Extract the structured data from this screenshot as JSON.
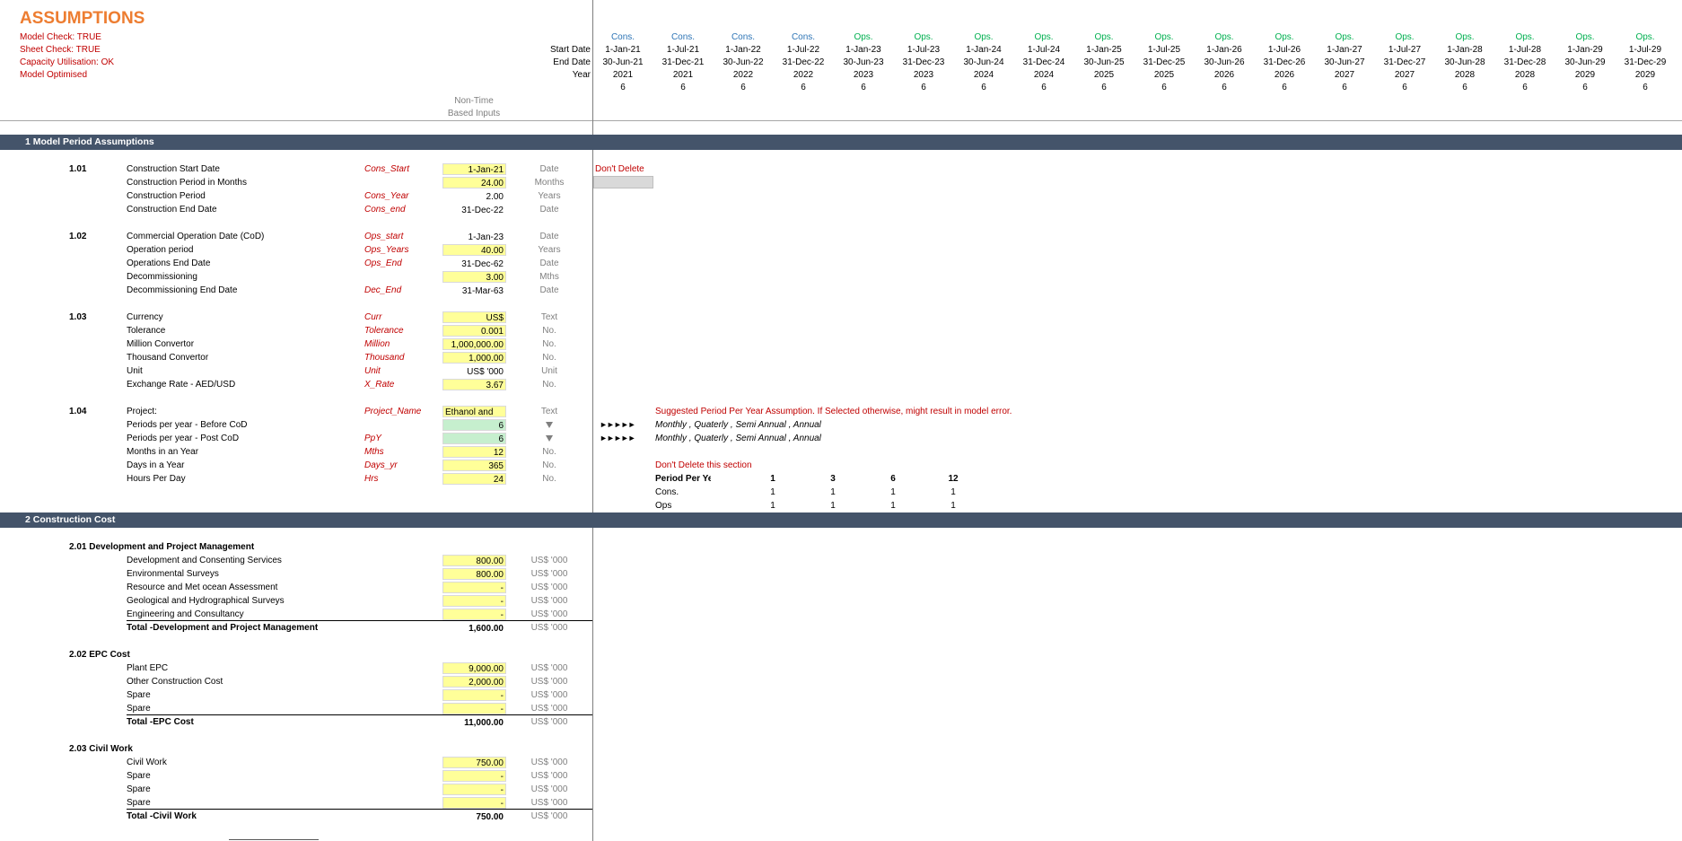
{
  "header": {
    "title": "ASSUMPTIONS",
    "checks": [
      "Model Check: TRUE",
      "Sheet Check: TRUE",
      "Capacity Utilisation: OK",
      "Model Optimised"
    ],
    "non_time_label_1": "Non-Time",
    "non_time_label_2": "Based Inputs"
  },
  "timeline": {
    "row_labels": [
      "Start Date",
      "End Date",
      "Year"
    ],
    "columns": [
      {
        "phase": "Cons.",
        "start": "1-Jan-21",
        "end": "30-Jun-21",
        "year": "2021",
        "periods": "6"
      },
      {
        "phase": "Cons.",
        "start": "1-Jul-21",
        "end": "31-Dec-21",
        "year": "2021",
        "periods": "6"
      },
      {
        "phase": "Cons.",
        "start": "1-Jan-22",
        "end": "30-Jun-22",
        "year": "2022",
        "periods": "6"
      },
      {
        "phase": "Cons.",
        "start": "1-Jul-22",
        "end": "31-Dec-22",
        "year": "2022",
        "periods": "6"
      },
      {
        "phase": "Ops.",
        "start": "1-Jan-23",
        "end": "30-Jun-23",
        "year": "2023",
        "periods": "6"
      },
      {
        "phase": "Ops.",
        "start": "1-Jul-23",
        "end": "31-Dec-23",
        "year": "2023",
        "periods": "6"
      },
      {
        "phase": "Ops.",
        "start": "1-Jan-24",
        "end": "30-Jun-24",
        "year": "2024",
        "periods": "6"
      },
      {
        "phase": "Ops.",
        "start": "1-Jul-24",
        "end": "31-Dec-24",
        "year": "2024",
        "periods": "6"
      },
      {
        "phase": "Ops.",
        "start": "1-Jan-25",
        "end": "30-Jun-25",
        "year": "2025",
        "periods": "6"
      },
      {
        "phase": "Ops.",
        "start": "1-Jul-25",
        "end": "31-Dec-25",
        "year": "2025",
        "periods": "6"
      },
      {
        "phase": "Ops.",
        "start": "1-Jan-26",
        "end": "30-Jun-26",
        "year": "2026",
        "periods": "6"
      },
      {
        "phase": "Ops.",
        "start": "1-Jul-26",
        "end": "31-Dec-26",
        "year": "2026",
        "periods": "6"
      },
      {
        "phase": "Ops.",
        "start": "1-Jan-27",
        "end": "30-Jun-27",
        "year": "2027",
        "periods": "6"
      },
      {
        "phase": "Ops.",
        "start": "1-Jul-27",
        "end": "31-Dec-27",
        "year": "2027",
        "periods": "6"
      },
      {
        "phase": "Ops.",
        "start": "1-Jan-28",
        "end": "30-Jun-28",
        "year": "2028",
        "periods": "6"
      },
      {
        "phase": "Ops.",
        "start": "1-Jul-28",
        "end": "31-Dec-28",
        "year": "2028",
        "periods": "6"
      },
      {
        "phase": "Ops.",
        "start": "1-Jan-29",
        "end": "30-Jun-29",
        "year": "2029",
        "periods": "6"
      },
      {
        "phase": "Ops.",
        "start": "1-Jul-29",
        "end": "31-Dec-29",
        "year": "2029",
        "periods": "6"
      }
    ]
  },
  "sections": {
    "s1": "1  Model Period Assumptions",
    "s2": "2  Construction Cost"
  },
  "model_period": {
    "g101": {
      "num": "1.01",
      "rows": [
        {
          "label": "Construction Start Date",
          "name": "Cons_Start",
          "value": "1-Jan-21",
          "unit": "Date"
        },
        {
          "label": "Construction Period in Months",
          "name": "",
          "value": "24.00",
          "unit": "Months"
        },
        {
          "label": "Construction Period",
          "name": "Cons_Year",
          "value": "2.00",
          "unit": "Years"
        },
        {
          "label": "Construction End Date",
          "name": "Cons_end",
          "value": "31-Dec-22",
          "unit": "Date"
        }
      ],
      "dont_delete": "Don't Delete"
    },
    "g102": {
      "num": "1.02",
      "rows": [
        {
          "label": "Commercial Operation Date (CoD)",
          "name": "Ops_start",
          "value": "1-Jan-23",
          "unit": "Date"
        },
        {
          "label": "Operation period",
          "name": "Ops_Years",
          "value": "40.00",
          "unit": "Years"
        },
        {
          "label": "Operations End Date",
          "name": "Ops_End",
          "value": "31-Dec-62",
          "unit": "Date"
        },
        {
          "label": "Decommissioning",
          "name": "",
          "value": "3.00",
          "unit": "Mths"
        },
        {
          "label": "Decommissioning End Date",
          "name": "Dec_End",
          "value": "31-Mar-63",
          "unit": "Date"
        }
      ]
    },
    "g103": {
      "num": "1.03",
      "rows": [
        {
          "label": "Currency",
          "name": "Curr",
          "value": "US$",
          "unit": "Text"
        },
        {
          "label": "Tolerance",
          "name": "Tolerance",
          "value": "0.001",
          "unit": "No."
        },
        {
          "label": "Million Convertor",
          "name": "Million",
          "value": "1,000,000.00",
          "unit": "No."
        },
        {
          "label": "Thousand Convertor",
          "name": "Thousand",
          "value": "1,000.00",
          "unit": "No."
        },
        {
          "label": "Unit",
          "name": "Unit",
          "value": "US$ '000",
          "unit": "Unit"
        },
        {
          "label": "Exchange Rate - AED/USD",
          "name": "X_Rate",
          "value": "3.67",
          "unit": "No."
        }
      ]
    },
    "g104": {
      "num": "1.04",
      "rows": [
        {
          "label": "Project:",
          "name": "Project_Name",
          "value": "Ethanol and Sugar",
          "unit": "Text"
        },
        {
          "label": "Periods per year - Before CoD",
          "name": "",
          "value": "6",
          "unit": ""
        },
        {
          "label": "Periods per year - Post CoD",
          "name": "PpY",
          "value": "6",
          "unit": ""
        },
        {
          "label": "Months in an Year",
          "name": "Mths",
          "value": "12",
          "unit": "No."
        },
        {
          "label": "Days in a Year",
          "name": "Days_yr",
          "value": "365",
          "unit": "No."
        },
        {
          "label": "Hours Per Day",
          "name": "Hrs",
          "value": "24",
          "unit": "No."
        }
      ],
      "note_suggested": "Suggested Period Per Year Assumption. If Selected otherwise, might result in model error.",
      "arrows": "►►►►►",
      "options": "Monthly , Quaterly , Semi Annual , Annual",
      "dont_delete_section": "Don't Delete this section",
      "ppy_table": {
        "header_label": "Period Per Ye",
        "headers": [
          "1",
          "3",
          "6",
          "12"
        ],
        "rows": [
          {
            "label": "Cons.",
            "values": [
              "1",
              "1",
              "1",
              "1"
            ]
          },
          {
            "label": "Ops",
            "values": [
              "1",
              "1",
              "1",
              "1"
            ]
          }
        ]
      }
    }
  },
  "construction_cost": {
    "g201": {
      "title": "2.01  Development and Project Management",
      "rows": [
        {
          "label": "Development and Consenting Services",
          "value": "800.00",
          "unit": "US$ '000"
        },
        {
          "label": "Environmental Surveys",
          "value": "800.00",
          "unit": "US$ '000"
        },
        {
          "label": "Resource and Met ocean Assessment",
          "value": "-",
          "unit": "US$ '000"
        },
        {
          "label": "Geological and Hydrographical Surveys",
          "value": "-",
          "unit": "US$ '000"
        },
        {
          "label": "Engineering and Consultancy",
          "value": "-",
          "unit": "US$ '000"
        }
      ],
      "total": {
        "label": "Total -Development and Project Management",
        "value": "1,600.00",
        "unit": "US$ '000"
      }
    },
    "g202": {
      "title": "2.02  EPC Cost",
      "rows": [
        {
          "label": "Plant EPC",
          "value": "9,000.00",
          "unit": "US$ '000"
        },
        {
          "label": "Other Construction Cost",
          "value": "2,000.00",
          "unit": "US$ '000"
        },
        {
          "label": "Spare",
          "value": "-",
          "unit": "US$ '000"
        },
        {
          "label": "Spare",
          "value": "-",
          "unit": "US$ '000"
        }
      ],
      "total": {
        "label": "Total -EPC Cost",
        "value": "11,000.00",
        "unit": "US$ '000"
      }
    },
    "g203": {
      "title": "2.03  Civil Work",
      "rows": [
        {
          "label": "Civil Work",
          "value": "750.00",
          "unit": "US$ '000"
        },
        {
          "label": "Spare",
          "value": "-",
          "unit": "US$ '000"
        },
        {
          "label": "Spare",
          "value": "-",
          "unit": "US$ '000"
        },
        {
          "label": "Spare",
          "value": "-",
          "unit": "US$ '000"
        }
      ],
      "total": {
        "label": "Total -Civil Work",
        "value": "750.00",
        "unit": "US$ '000"
      }
    }
  }
}
